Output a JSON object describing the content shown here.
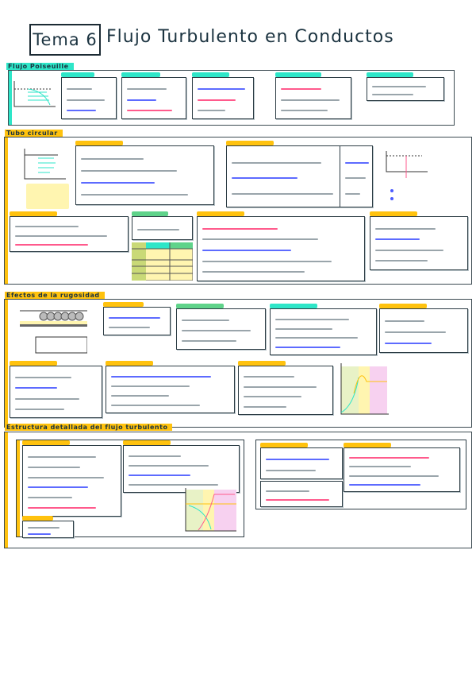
{
  "header": {
    "topic_label": "Tema 6",
    "title": "Flujo Turbulento en Conductos"
  },
  "sections": [
    {
      "title": "Flujo Poiseuille",
      "color": "#2ee6c8"
    },
    {
      "title": "Tubo circular",
      "color": "#ffc20e"
    },
    {
      "title": "Efectos de la rugosidad",
      "color": "#ffc20e"
    },
    {
      "title": "Estructura detallada del flujo turbulento",
      "color": "#ffc20e"
    }
  ],
  "colors": {
    "ink": "#1b3340",
    "teal": "#2ee6c8",
    "yellow": "#ffc20e",
    "green": "#5fd38a",
    "pink": "#ff5a8c",
    "blue": "#4b5bff",
    "highlight_yellow": "#fff5b0",
    "highlight_pink": "#f7d1f0"
  }
}
